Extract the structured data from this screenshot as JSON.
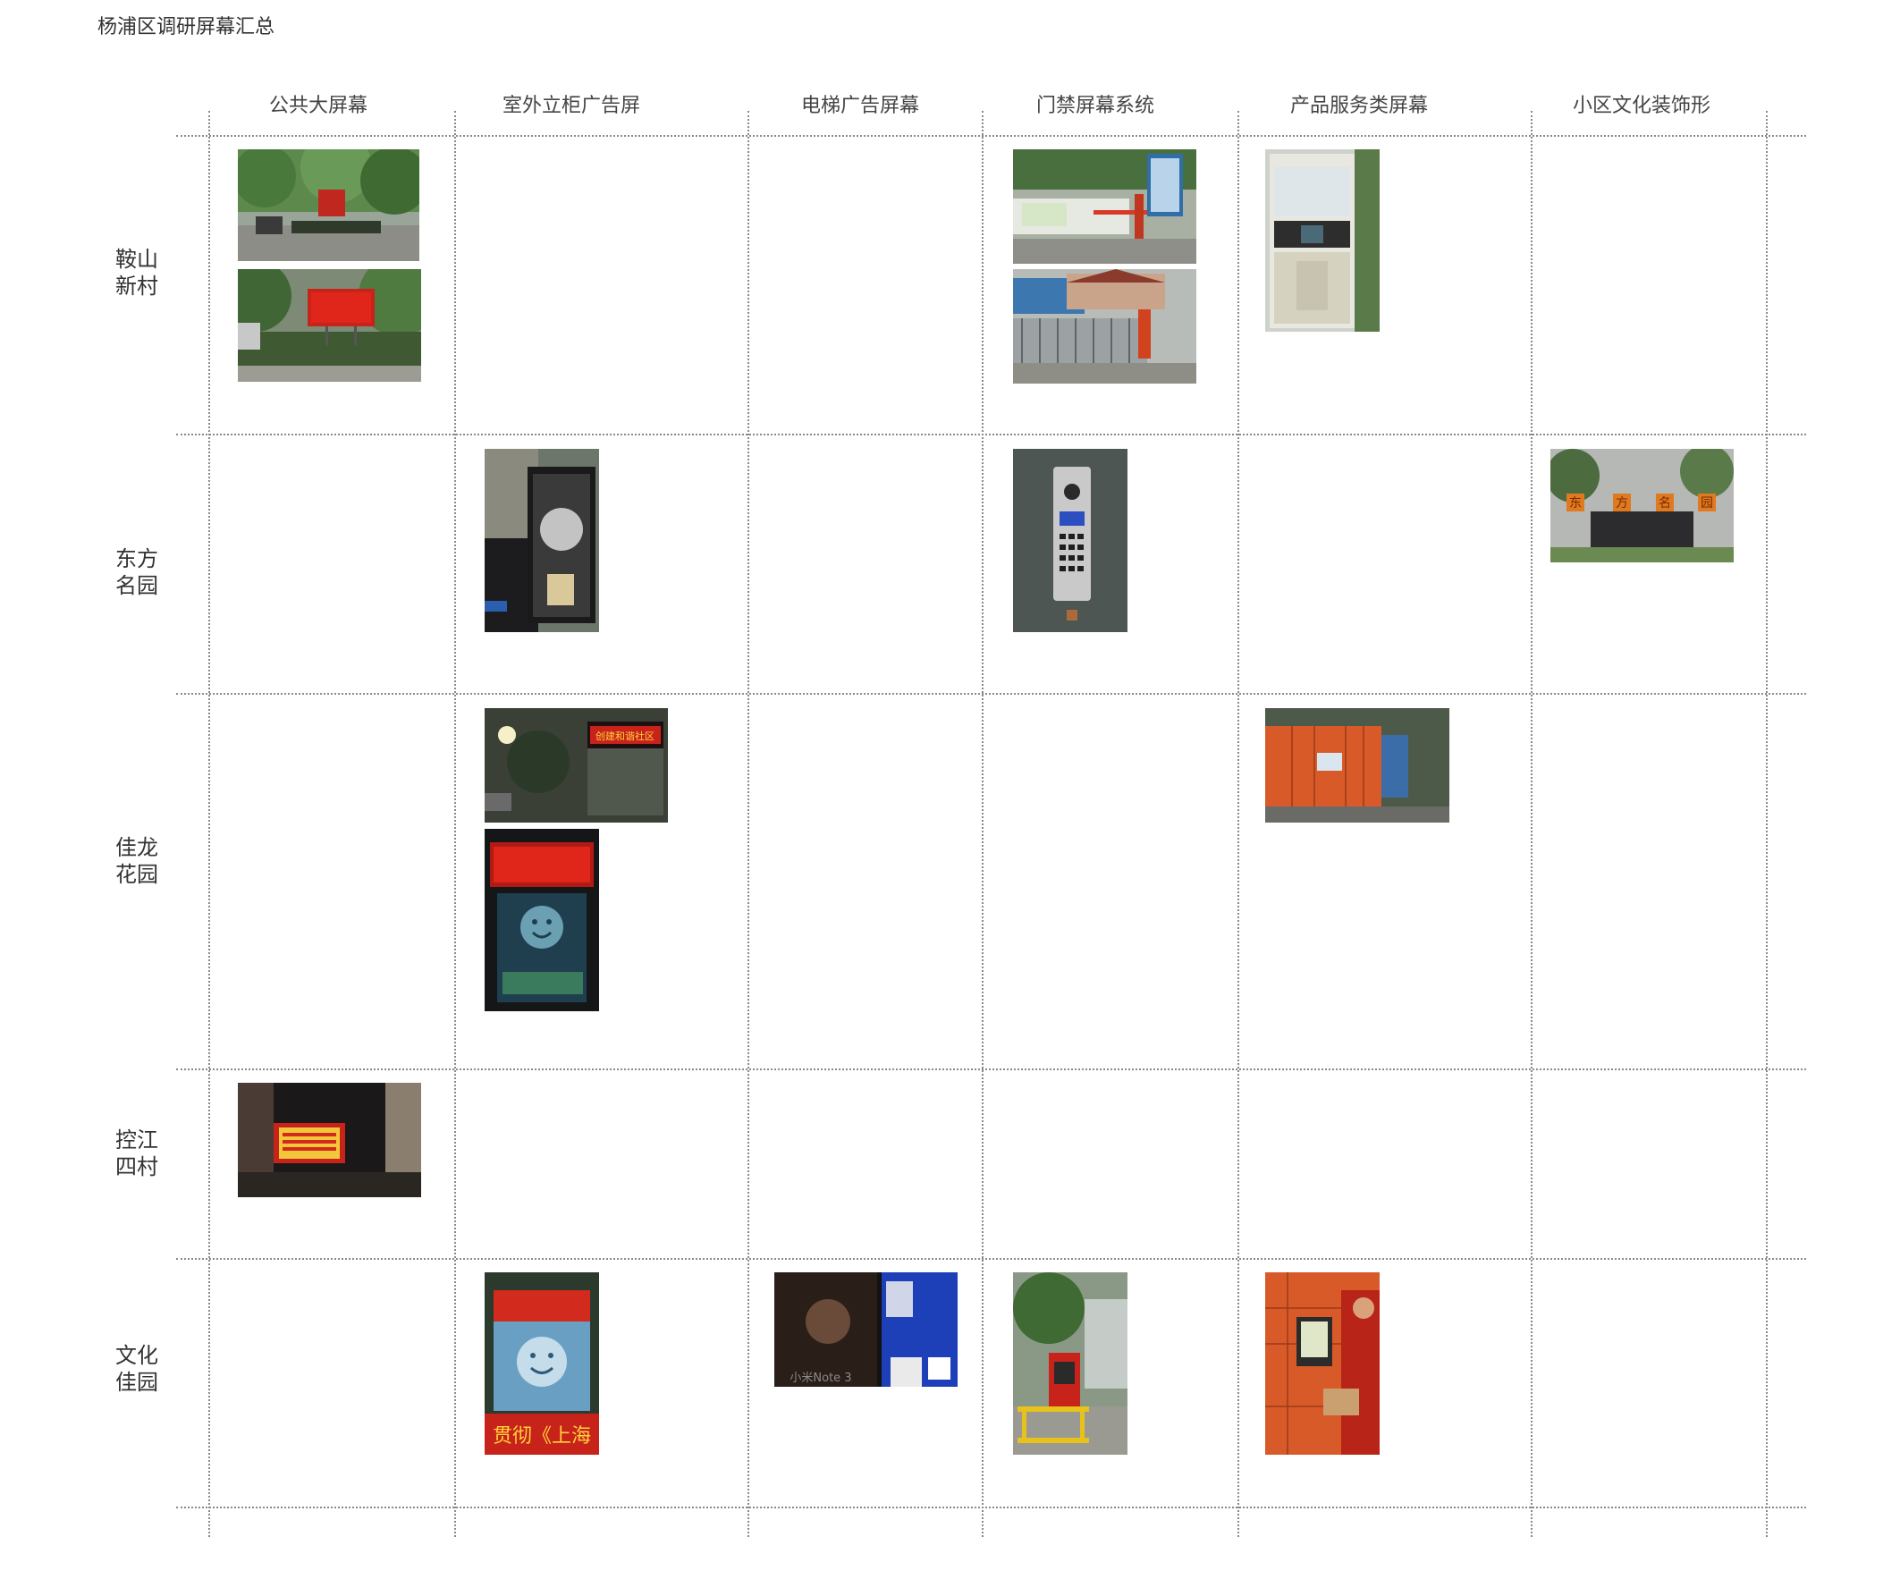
{
  "page_title": "杨浦区调研屏幕汇总",
  "columns": [
    "公共大屏幕",
    "室外立柜广告屏",
    "电梯广告屏幕",
    "门禁屏幕系统",
    "产品服务类屏幕",
    "小区文化装饰形"
  ],
  "rows": [
    {
      "label_line1": "鞍山",
      "label_line2": "新村"
    },
    {
      "label_line1": "东方",
      "label_line2": "名园"
    },
    {
      "label_line1": "佳龙",
      "label_line2": "花园"
    },
    {
      "label_line1": "控江",
      "label_line2": "四村"
    },
    {
      "label_line1": "文化",
      "label_line2": "佳园"
    }
  ],
  "photo_texts": {
    "dongfang_sign": [
      "东",
      "方",
      "名",
      "园"
    ],
    "jialong_led": "创建和谐社区",
    "wenhua_banner": "贯彻《上海",
    "elevator_watermark": "小米Note 3"
  },
  "colors": {
    "grid_line": "#8a8a8a",
    "led_red": "#e0261b",
    "locker_orange": "#e0602a"
  }
}
